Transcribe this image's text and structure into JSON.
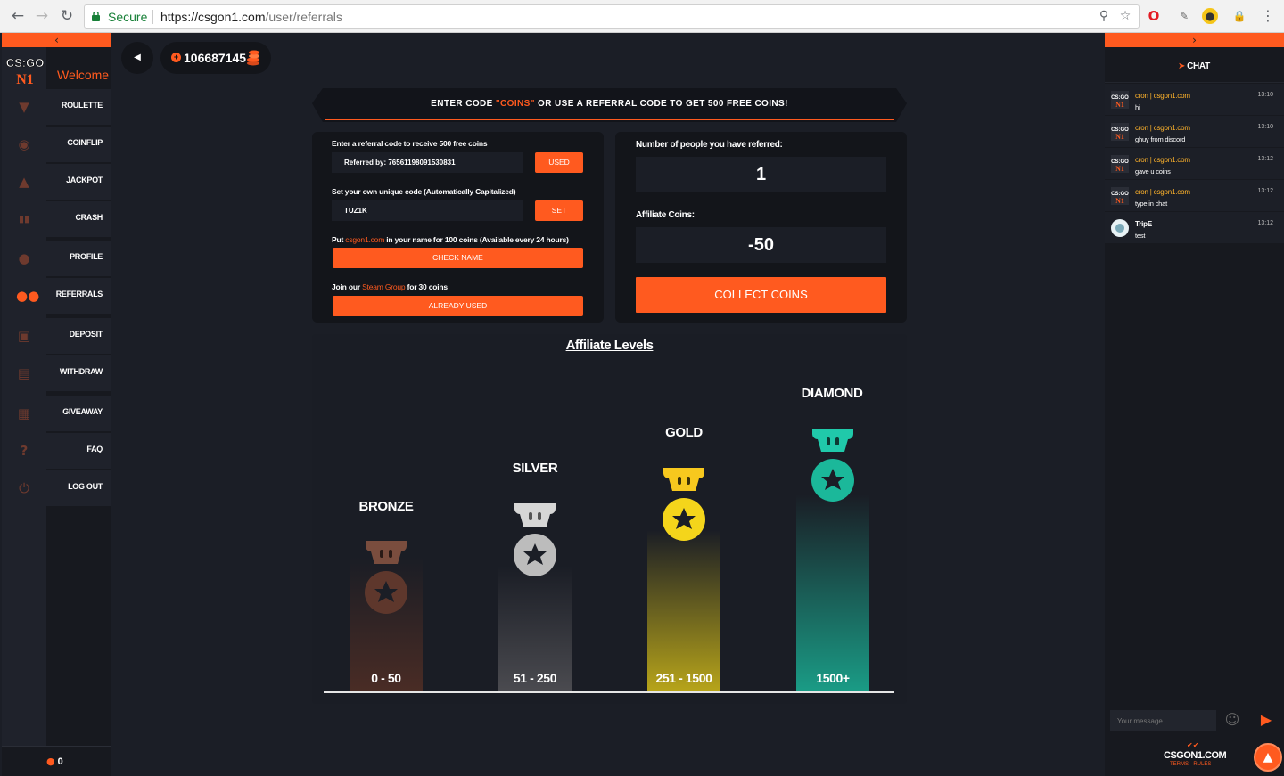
{
  "browser": {
    "secure_label": "Secure",
    "url_host": "https://csgon1.com",
    "url_path": "/user/referrals"
  },
  "sidebar": {
    "logo_text": "CS:GO",
    "welcome": "Welcome",
    "items": [
      {
        "label": "ROULETTE",
        "icon": "hat-icon"
      },
      {
        "label": "COINFLIP",
        "icon": "coin-icon"
      },
      {
        "label": "JACKPOT",
        "icon": "money-bag-icon"
      },
      {
        "label": "CRASH",
        "icon": "chart-icon"
      },
      {
        "label": "PROFILE",
        "icon": "user-icon"
      },
      {
        "label": "REFERRALS",
        "icon": "users-icon"
      },
      {
        "label": "DEPOSIT",
        "icon": "deposit-icon"
      },
      {
        "label": "WITHDRAW",
        "icon": "cart-icon"
      },
      {
        "label": "GIVEAWAY",
        "icon": "gift-icon"
      },
      {
        "label": "FAQ",
        "icon": "question-icon"
      },
      {
        "label": "LOG OUT",
        "icon": "power-icon"
      }
    ],
    "online_count": "0"
  },
  "header": {
    "balance": "106687145"
  },
  "banner": {
    "prefix": "ENTER CODE ",
    "code": "\"COINS\"",
    "suffix": " OR USE A REFERRAL CODE TO GET 500 FREE COINS!"
  },
  "referral_panel": {
    "enter_label": "Enter a referral code to receive 500 free coins",
    "referred_value": "Referred by: 76561198091530831",
    "used_btn": "USED",
    "own_code_label": "Set your own unique code  (Automatically Capitalized)",
    "own_code_value": "TUZ1K",
    "set_btn": "SET",
    "name_label_prefix": "Put ",
    "name_label_site": "csgon1.com",
    "name_label_suffix": " in your name for 100 coins (Available every 24 hours)",
    "check_name_btn": "CHECK NAME",
    "steam_label_prefix": "Join our ",
    "steam_label_link": "Steam Group",
    "steam_label_suffix": " for 30 coins",
    "already_used_btn": "ALREADY USED"
  },
  "stats_panel": {
    "referred_label": "Number of people you have referred:",
    "referred_value": "1",
    "coins_label": "Affiliate Coins:",
    "coins_value": "-50",
    "collect_btn": "COLLECT COINS"
  },
  "levels": {
    "title": "Affiliate Levels",
    "tiers": [
      {
        "name": "BRONZE",
        "range": "0 - 50",
        "color": "#6b3d2e"
      },
      {
        "name": "SILVER",
        "range": "51 - 250",
        "color": "#c9c9c9"
      },
      {
        "name": "GOLD",
        "range": "251 - 1500",
        "color": "#f0d21a"
      },
      {
        "name": "DIAMOND",
        "range": "1500+",
        "color": "#1fc7a8"
      }
    ]
  },
  "chat": {
    "title": "CHAT",
    "messages": [
      {
        "user": "cron | csgon1.com",
        "text": "hi",
        "time": "13:10"
      },
      {
        "user": "cron | csgon1.com",
        "text": "ghuy from discord",
        "time": "13:10"
      },
      {
        "user": "cron | csgon1.com",
        "text": "gave u coins",
        "time": "13:12"
      },
      {
        "user": "cron | csgon1.com",
        "text": "type in chat",
        "time": "13:12"
      },
      {
        "user": "TripE",
        "text": "test",
        "time": "13:12"
      }
    ],
    "input_placeholder": "Your message..",
    "footer_brand": "CSGON1.COM",
    "footer_links": "TERMS - RULES"
  },
  "colors": {
    "accent": "#ff5a1f",
    "background": "#1b1e26",
    "panel": "#13151a"
  }
}
